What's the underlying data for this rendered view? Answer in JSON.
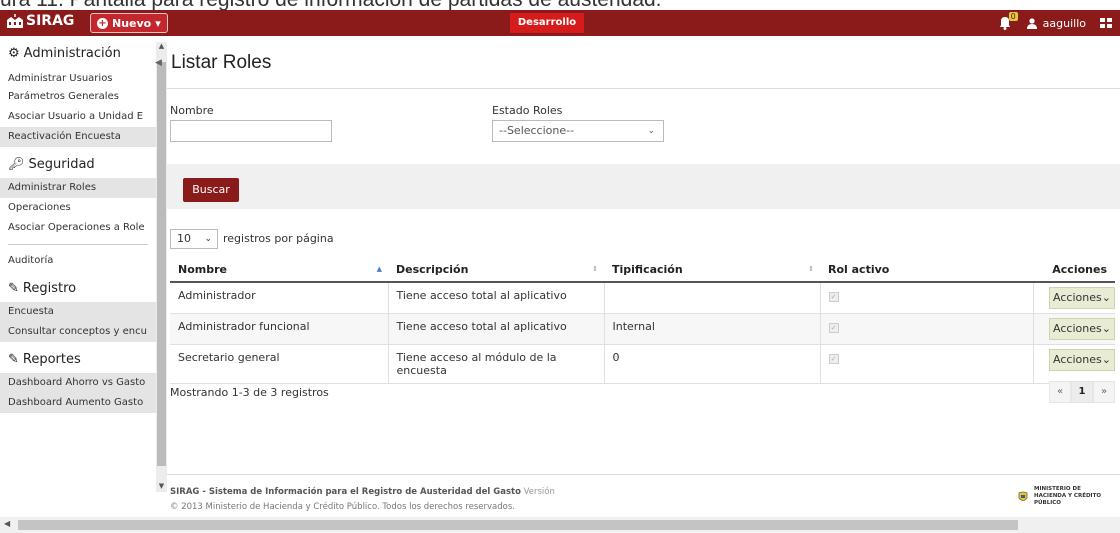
{
  "caption": "ura 11. Pantalla para registro de información de partidas de austeridad.",
  "topbar": {
    "app_name": "SIRAG",
    "new_button": "Nuevo",
    "environment": "Desarrollo",
    "notification_count": "0",
    "username": "aaguillo",
    "colors": {
      "bar": "#8b1a1a",
      "badge": "#d41c1c"
    }
  },
  "sidebar": {
    "admin_header": "Administración",
    "admin_items": [
      "Administrar Usuarios",
      "Parámetros Generales",
      "Asociar Usuario a Unidad E",
      "Reactivación Encuesta"
    ],
    "security_header": "Seguridad",
    "security_items": [
      "Administrar Roles",
      "Operaciones",
      "Asociar Operaciones a Role"
    ],
    "audit_item": "Auditoría",
    "registry_header": "Registro",
    "registry_items": [
      "Encuesta",
      "Consultar conceptos y encu"
    ],
    "reports_header": "Reportes",
    "reports_items": [
      "Dashboard Ahorro vs Gasto",
      "Dashboard Aumento Gasto"
    ]
  },
  "page": {
    "title": "Listar Roles",
    "filters": {
      "name_label": "Nombre",
      "name_value": "",
      "state_label": "Estado Roles",
      "state_value": "--Seleccione--"
    },
    "search_button": "Buscar",
    "page_size": "10",
    "per_page_label": "registros por página",
    "table": {
      "columns": [
        "Nombre",
        "Descripción",
        "Tipificación",
        "Rol activo",
        "Acciones"
      ],
      "rows": [
        {
          "nombre": "Administrador",
          "descripcion": "Tiene acceso total al aplicativo",
          "tipificacion": "",
          "activo": true,
          "accion": "Acciones"
        },
        {
          "nombre": "Administrador funcional",
          "descripcion": "Tiene acceso total al aplicativo",
          "tipificacion": "Internal",
          "activo": true,
          "accion": "Acciones"
        },
        {
          "nombre": "Secretario general",
          "descripcion": "Tiene acceso al módulo de la encuesta",
          "tipificacion": "0",
          "activo": true,
          "accion": "Acciones"
        }
      ]
    },
    "showing": "Mostrando 1-3 de 3 registros",
    "pager": {
      "prev": "«",
      "current": "1",
      "next": "»"
    }
  },
  "footer": {
    "system_name": "SIRAG - Sistema de Información para el Registro de Austeridad del Gasto",
    "version_label": "Versión",
    "copyright": "© 2013 Ministerio de Hacienda y Crédito Público. Todos los derechos reservados.",
    "ministry": "MINISTERIO DE HACIENDA Y CRÉDITO PÚBLICO"
  }
}
